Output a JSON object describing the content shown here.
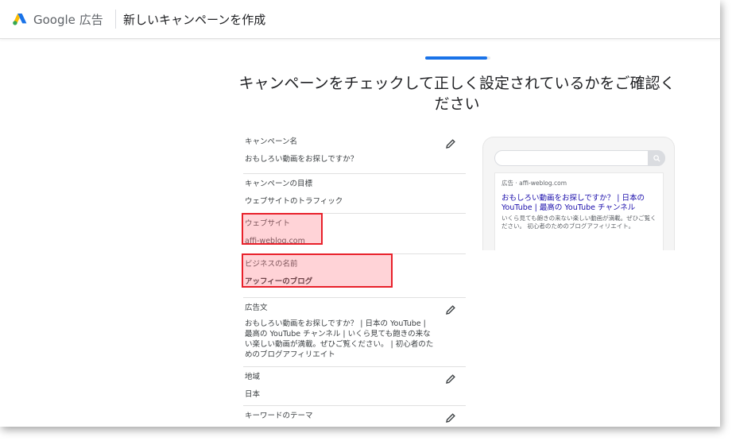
{
  "header": {
    "brand_name": "Google",
    "brand_product": "広告",
    "page_title": "新しいキャンペーンを作成"
  },
  "progress": {
    "fraction": 0.95
  },
  "heading": "キャンペーンをチェックして正しく設定されているかをご確認ください",
  "summary": [
    {
      "label": "キャンペーン名",
      "value": "おもしろい動画をお探しですか？",
      "editable": true
    },
    {
      "label": "キャンペーンの目標",
      "value": "ウェブサイトのトラフィック",
      "editable": false
    },
    {
      "label": "ウェブサイト",
      "value": "affi-weblog.com",
      "editable": false
    },
    {
      "label": "ビジネスの名前",
      "value": "アッフィーのブログ",
      "editable": false
    },
    {
      "label": "広告文",
      "value": "おもしろい動画をお探しですか？ | 日本の YouTube | 最高の YouTube チャンネル | いくら見ても飽きの来ない楽しい動画が満載。ぜひご覧ください。 | 初心者のためのブログアフィリエイト",
      "editable": true
    },
    {
      "label": "地域",
      "value": "日本",
      "editable": true
    },
    {
      "label": "キーワードのテーマ",
      "value": "",
      "editable": true
    }
  ],
  "preview": {
    "ad_label": "広告 · affi-weblog.com",
    "ad_title": "おもしろい動画をお探しですか？ | 日本の YouTube | 最高の YouTube チャンネル",
    "ad_description": "いくら見ても飽きの来ない楽しい動画が満載。ぜひご覧ください。 初心者のためのブログアフィリエイト。"
  },
  "colors": {
    "accent": "#1a73e8",
    "highlight_border": "#e8202a",
    "link": "#1a0dab"
  },
  "icons": {
    "edit": "pencil-icon",
    "search": "search-icon",
    "logo": "google-ads-logo"
  }
}
